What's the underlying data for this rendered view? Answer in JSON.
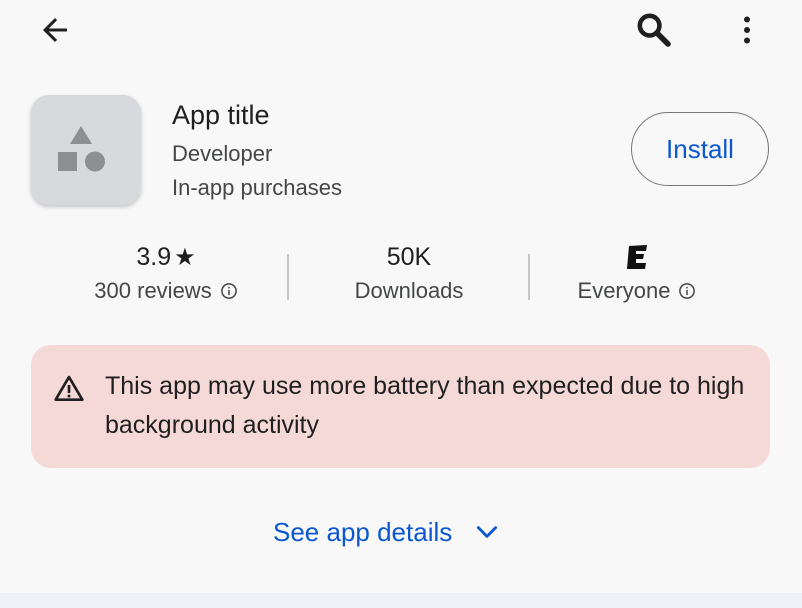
{
  "app": {
    "title": "App title",
    "developer": "Developer",
    "purchases": "In-app purchases"
  },
  "install": {
    "label": "Install"
  },
  "stats": {
    "rating": {
      "value": "3.9",
      "star": "★",
      "label": "300 reviews"
    },
    "downloads": {
      "value": "50K",
      "label": "Downloads"
    },
    "content_rating": {
      "badge": "E",
      "label": "Everyone"
    }
  },
  "warning": {
    "text": "This app may use more battery than expected due to high background activity"
  },
  "details": {
    "label": "See app details"
  },
  "icons": {
    "back": "arrow-back-icon",
    "search": "search-icon",
    "more": "more-vert-icon",
    "info": "info-icon",
    "warning": "warning-icon",
    "chevron": "chevron-down-icon"
  },
  "colors": {
    "accent": "#0b57d0",
    "warning_bg": "#f5d9d7",
    "background": "#f8f8f8"
  }
}
